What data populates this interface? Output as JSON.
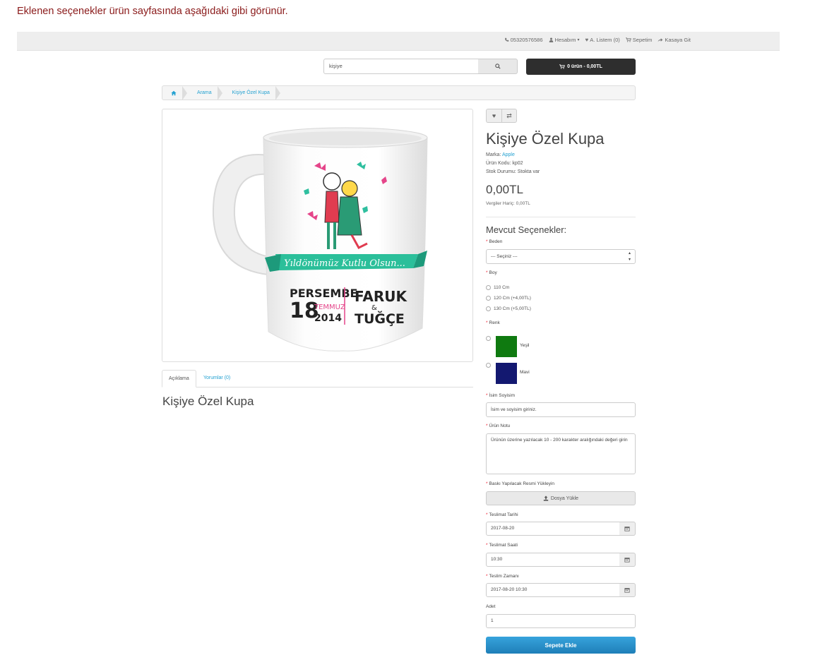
{
  "intro_text": "Eklenen seçenekler ürün sayfasında aşağıdaki gibi görünür.",
  "topbar": {
    "phone": "05320576586",
    "account": "Hesabım",
    "wishlist": "A. Listem (0)",
    "cart": "Sepetim",
    "checkout": "Kasaya Git"
  },
  "search": {
    "value": "kişiye"
  },
  "cart_button": "0 ürün - 0,00TL",
  "breadcrumb": {
    "items": [
      "Arama",
      "Kişiye Özel Kupa"
    ]
  },
  "mug": {
    "banner": "Yıldönümüz Kutlu Olsun...",
    "day_name": "PERSEMBE",
    "day": "18",
    "month": "TEMMUZ",
    "year": "2014",
    "name1": "FARUK",
    "amp": "&",
    "name2": "TUĞÇE"
  },
  "tabs": {
    "description": "Açıklama",
    "reviews": "Yorumlar (0)"
  },
  "description_title": "Kişiye Özel Kupa",
  "product": {
    "title": "Kişiye Özel Kupa",
    "brand_label": "Marka:",
    "brand": "Apple",
    "code": "Ürün Kodu: kp02",
    "stock": "Stok Durumu: Stokta var",
    "price": "0,00TL",
    "tax": "Vergiler Hariç: 0,00TL"
  },
  "options": {
    "heading": "Mevcut Seçenekler:",
    "size_label": "Beden",
    "size_select": "--- Seçiniz ---",
    "height_label": "Boy",
    "heights": [
      "110 Cm",
      "120 Cm (+4,00TL)",
      "130 Cm (+5,00TL)"
    ],
    "color_label": "Renk",
    "colors": [
      {
        "name": "Yeşil",
        "hex": "#0f7a10"
      },
      {
        "name": "Mavi",
        "hex": "#131870"
      }
    ],
    "name_label": "İsim Soyisim",
    "name_value": "İsim ve soyisim giriniz.",
    "note_label": "Ürün Notu",
    "note_value": "Ürünün üzerine yazılacak 10 - 200 karakter aralığındaki değeri girin",
    "upload_label": "Baskı Yapılacak Resmi Yükleyin",
    "upload_button": "Dosya Yükle",
    "date_label": "Teslimat Tarihi",
    "date_value": "2017-08-20",
    "time_label": "Teslimat Saati",
    "time_value": "10:30",
    "datetime_label": "Teslim Zamanı",
    "datetime_value": "2017-08-20 10:30",
    "qty_label": "Adet",
    "qty_value": "1"
  },
  "add_to_cart": "Sepete Ekle"
}
